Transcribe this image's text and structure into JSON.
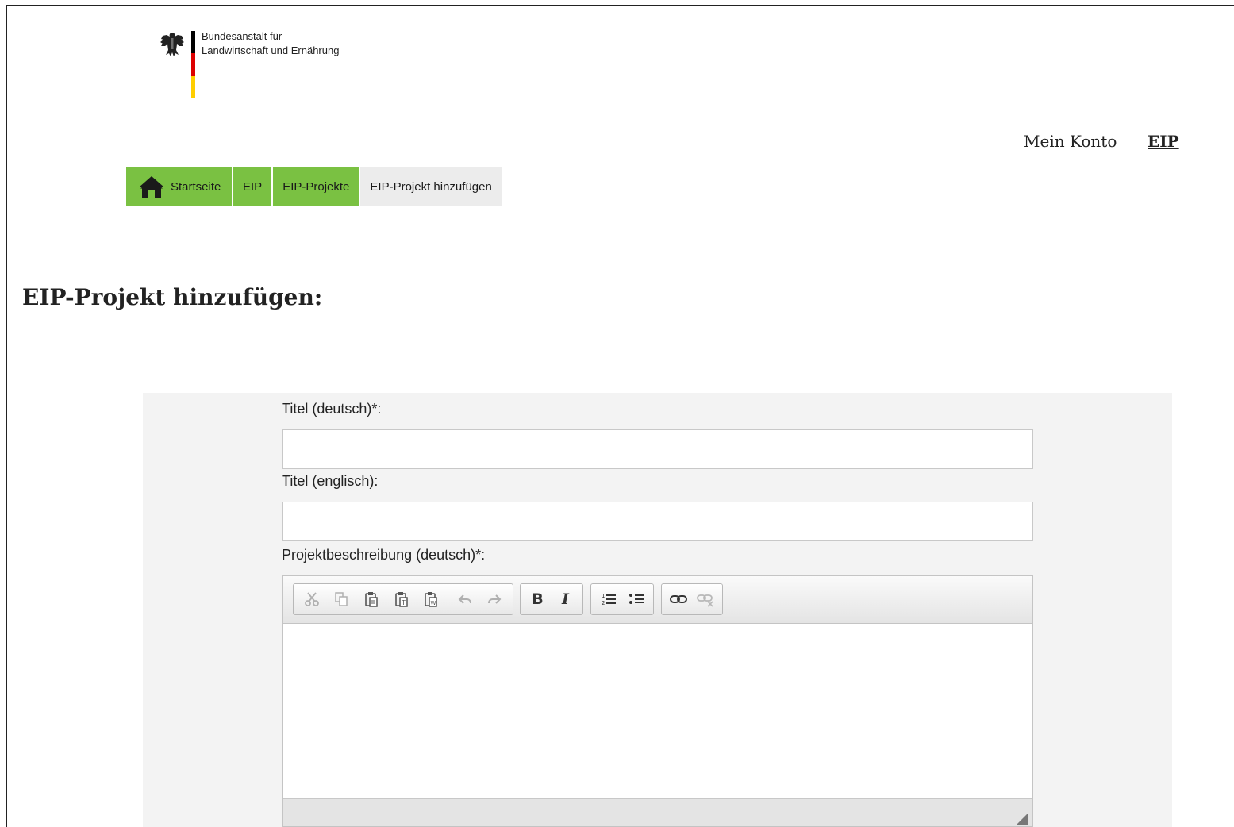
{
  "logo": {
    "line1": "Bundesanstalt für",
    "line2": "Landwirtschaft und Ernährung",
    "colors": [
      "#000000",
      "#dd0000",
      "#ffce00"
    ]
  },
  "top_links": {
    "account": "Mein Konto",
    "eip": "EIP"
  },
  "breadcrumb": {
    "items": [
      {
        "label": "Startseite",
        "icon": "home-icon"
      },
      {
        "label": "EIP"
      },
      {
        "label": "EIP-Projekte"
      },
      {
        "label": "EIP-Projekt hinzufügen"
      }
    ],
    "active_color": "#7ac142"
  },
  "page": {
    "title": "EIP-Projekt hinzufügen:"
  },
  "form": {
    "title_de_label": "Titel (deutsch)*:",
    "title_de_value": "",
    "title_en_label": "Titel (englisch):",
    "title_en_value": "",
    "desc_de_label": "Projektbeschreibung (deutsch)*:"
  },
  "editor_toolbar": {
    "buttons": [
      "cut-icon",
      "copy-icon",
      "paste-icon",
      "paste-text-icon",
      "paste-word-icon",
      "undo-icon",
      "redo-icon",
      "bold-icon",
      "italic-icon",
      "numbered-list-icon",
      "bulleted-list-icon",
      "link-icon",
      "unlink-icon"
    ],
    "bold_glyph": "B",
    "italic_glyph": "I"
  }
}
